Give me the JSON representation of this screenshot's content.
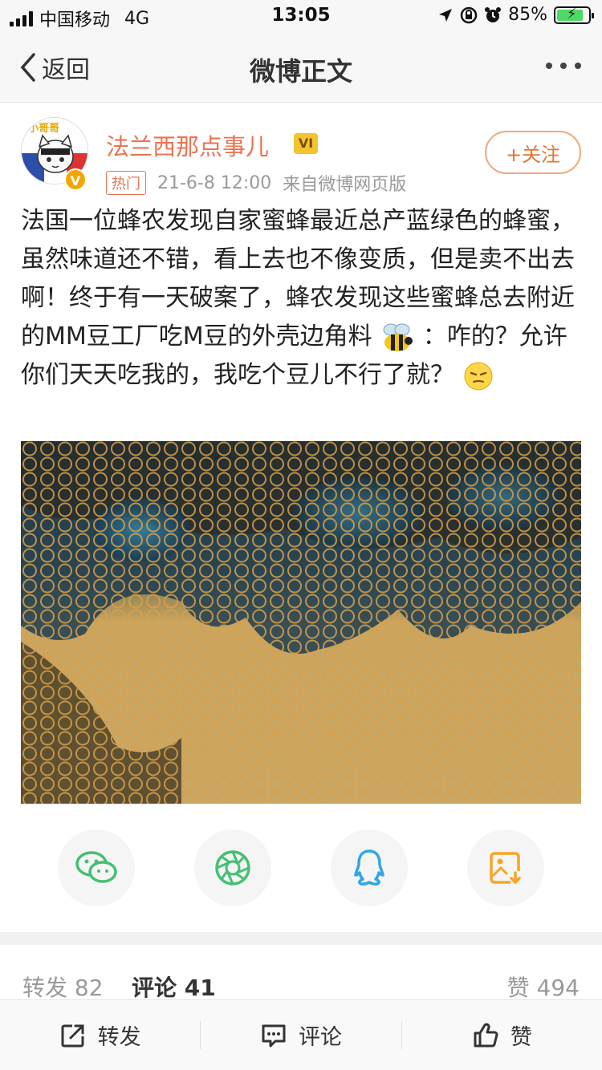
{
  "status_bar": {
    "carrier": "中国移动",
    "network": "4G",
    "time": "13:05",
    "battery_percent": "85%",
    "battery_level": 0.85
  },
  "navbar": {
    "back_label": "返回",
    "title": "微博正文"
  },
  "author": {
    "name": "法兰西那点事儿",
    "avatar_text": "小哥哥",
    "badge": "V",
    "hot_tag": "热门",
    "time": "21-6-8 12:00",
    "source": "来自微博网页版",
    "follow_label": "+关注"
  },
  "post": {
    "text_part1": "法国一位蜂农发现自家蜜蜂最近总产蓝绿色的蜂蜜，虽然味道还不错，看上去也不像变质，但是卖不出去啊！终于有一天破案了，蜂农发现这些蜜蜂总去附近的MM豆工厂吃M豆的外壳边角料 ",
    "text_part2": "：咋的？允许你们天天吃我的，我吃个豆儿不行了就？",
    "emoji1": "bee-emoji",
    "emoji2": "smirk-emoji"
  },
  "share": {
    "icons": [
      "wechat-icon",
      "moments-icon",
      "qq-icon",
      "save-image-icon"
    ]
  },
  "stats": {
    "repost": "转发 82",
    "comment": "评论 41",
    "like": "赞 494"
  },
  "toolbar": {
    "repost_label": "转发",
    "comment_label": "评论",
    "like_label": "赞"
  },
  "colors": {
    "accent_orange": "#eb7350",
    "wechat_green": "#44c073",
    "qq_blue": "#2fa6e6",
    "save_orange": "#f5a623"
  }
}
